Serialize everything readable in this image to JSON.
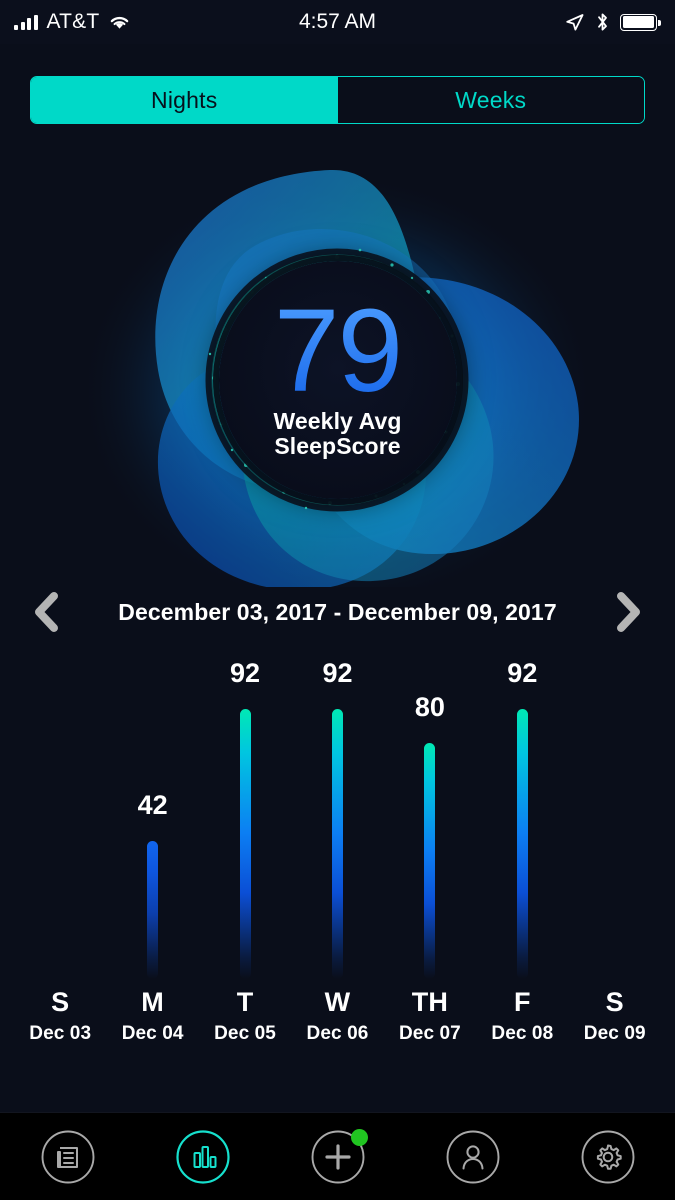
{
  "status_bar": {
    "carrier": "AT&T",
    "time": "4:57 AM",
    "icons": [
      "signal-icon",
      "wifi-icon",
      "location-arrow-icon",
      "bluetooth-icon",
      "battery-icon"
    ]
  },
  "segmented_control": {
    "options": [
      {
        "label": "Nights",
        "active": true
      },
      {
        "label": "Weeks",
        "active": false
      }
    ],
    "active_bg": "#00d9c8",
    "active_text": "#07101c",
    "inactive_text": "#00d9c8"
  },
  "hero": {
    "score": "79",
    "label_line1": "Weekly Avg",
    "label_line2": "SleepScore",
    "score_color": "#2b7cf0",
    "ring_color": "#16d7c4"
  },
  "date_nav": {
    "prev_label": "previous-week",
    "next_label": "next-week",
    "range": "December 03, 2017 - December 09, 2017"
  },
  "chart_data": {
    "type": "bar",
    "title": "",
    "xlabel": "",
    "ylabel": "",
    "ylim": [
      0,
      100
    ],
    "grid": false,
    "legend": "none",
    "categories": [
      "S",
      "M",
      "T",
      "W",
      "TH",
      "F",
      "S"
    ],
    "tick_sublabels": [
      "Dec 03",
      "Dec 04",
      "Dec 05",
      "Dec 06",
      "Dec 07",
      "Dec 08",
      "Dec 09"
    ],
    "values": [
      null,
      42,
      92,
      92,
      80,
      92,
      null
    ],
    "value_labels": [
      "",
      "42",
      "92",
      "92",
      "80",
      "92",
      ""
    ],
    "bars": [
      {
        "day": "S",
        "date": "Dec 03",
        "value": null,
        "label": ""
      },
      {
        "day": "M",
        "date": "Dec 04",
        "value": 42,
        "label": "42"
      },
      {
        "day": "T",
        "date": "Dec 05",
        "value": 92,
        "label": "92"
      },
      {
        "day": "W",
        "date": "Dec 06",
        "value": 92,
        "label": "92"
      },
      {
        "day": "TH",
        "date": "Dec 07",
        "value": 80,
        "label": "80"
      },
      {
        "day": "F",
        "date": "Dec 08",
        "value": 92,
        "label": "92"
      },
      {
        "day": "S",
        "date": "Dec 09",
        "value": null,
        "label": ""
      }
    ],
    "bar_gradient_top": "#00e9b4",
    "bar_gradient_bottom": "#0a0e1a"
  },
  "tabbar": {
    "items": [
      {
        "name": "news-icon",
        "active": false,
        "badge": false
      },
      {
        "name": "chart-icon",
        "active": true,
        "badge": false
      },
      {
        "name": "plus-icon",
        "active": false,
        "badge": true
      },
      {
        "name": "profile-icon",
        "active": false,
        "badge": false
      },
      {
        "name": "gear-icon",
        "active": false,
        "badge": false
      }
    ],
    "active_color": "#16e0cd",
    "inactive_color": "#a9a9a9",
    "badge_color": "#21c521"
  }
}
